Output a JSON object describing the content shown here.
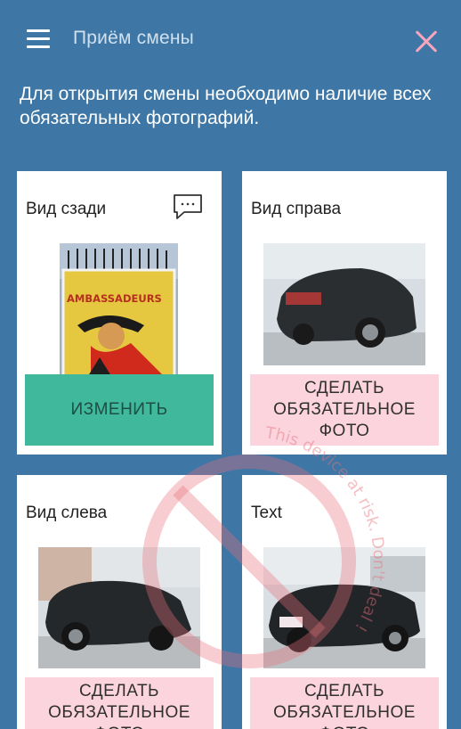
{
  "header": {
    "title": "Приём смены",
    "menu_icon": "hamburger-menu-icon",
    "close_icon": "close-icon"
  },
  "notice": "Для открытия смены необходимо наличие всех обязательных фотографий.",
  "cards": [
    {
      "title": "Вид сзади",
      "action_label": "ИЗМЕНИТЬ",
      "has_comment_icon": true
    },
    {
      "title": "Вид справа",
      "action_label": "СДЕЛАТЬ ОБЯЗАТЕЛЬНОЕ ФОТО"
    },
    {
      "title": "Вид слева",
      "action_label": "СДЕЛАТЬ ОБЯЗАТЕЛЬНОЕ ФОТО"
    },
    {
      "title": "Text",
      "action_label": "СДЕЛАТЬ ОБЯЗАТЕЛЬНОЕ ФОТО"
    }
  ],
  "photo_texts": {
    "notebook_brand": "AMBASSADEURS"
  },
  "watermark": {
    "text": "This device at risk. Don't deal !"
  },
  "colors": {
    "background": "#3e77a6",
    "title_text": "#cfe0ee",
    "close_icon": "#f7a6bd",
    "required_button": "#fbd4dd",
    "change_button": "#3fb89b",
    "watermark": "#e8707a"
  }
}
